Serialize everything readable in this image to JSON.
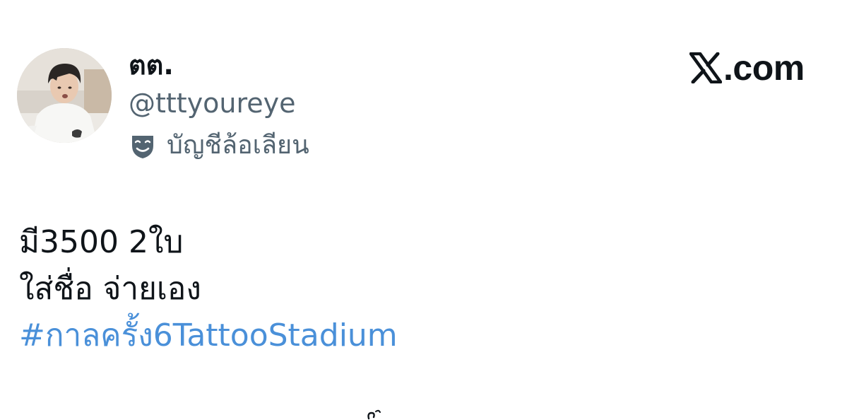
{
  "author": {
    "display_name": "ตต.",
    "handle": "@tttyoureye",
    "badge_label": "บัญชีล้อเลียน",
    "badge_icon": "parody-mask-icon"
  },
  "brand": {
    "icon": "x-logo-icon",
    "text": ".com"
  },
  "tweet": {
    "lines": [
      "มี3500 2ใบ",
      "ใส่ชื่อ จ่ายเอง"
    ],
    "hashtag": "#กาลครั้ง6TattooStadium"
  },
  "colors": {
    "text_primary": "#0f1419",
    "text_secondary": "#536471",
    "link": "#4a90d9",
    "background": "#ffffff"
  }
}
